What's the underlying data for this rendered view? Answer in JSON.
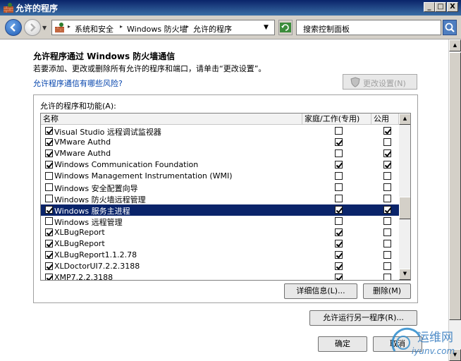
{
  "window": {
    "title": "允许的程序",
    "minimize": "_",
    "maximize": "□",
    "close": "X"
  },
  "address": {
    "crumbs": [
      "系统和安全",
      "Windows 防火墙",
      "允许的程序"
    ],
    "search_placeholder": "搜索控制面板"
  },
  "main": {
    "heading": "允许程序通过 Windows 防火墙通信",
    "description": "若要添加、更改或删除所有允许的程序和端口，请单击“更改设置”。",
    "risk_link": "允许程序通信有哪些风险?",
    "change_settings": "更改设置(N)",
    "group_label": "允许的程序和功能(A):",
    "columns": {
      "name": "名称",
      "home": "家庭/工作(专用)",
      "public": "公用"
    },
    "rows": [
      {
        "name": "Visual Studio 远程调试监视器",
        "enabled": true,
        "home": false,
        "public": true,
        "selected": false
      },
      {
        "name": "VMware Authd",
        "enabled": true,
        "home": true,
        "public": false,
        "selected": false
      },
      {
        "name": "VMware Authd",
        "enabled": true,
        "home": false,
        "public": true,
        "selected": false
      },
      {
        "name": "Windows Communication Foundation",
        "enabled": true,
        "home": true,
        "public": true,
        "selected": false
      },
      {
        "name": "Windows Management Instrumentation (WMI)",
        "enabled": false,
        "home": false,
        "public": false,
        "selected": false
      },
      {
        "name": "Windows 安全配置向导",
        "enabled": false,
        "home": false,
        "public": false,
        "selected": false
      },
      {
        "name": "Windows 防火墙远程管理",
        "enabled": false,
        "home": false,
        "public": false,
        "selected": false
      },
      {
        "name": "Windows 服务主进程",
        "enabled": true,
        "home": true,
        "public": true,
        "selected": true
      },
      {
        "name": "Windows 远程管理",
        "enabled": false,
        "home": false,
        "public": false,
        "selected": false
      },
      {
        "name": "XLBugReport",
        "enabled": true,
        "home": true,
        "public": false,
        "selected": false
      },
      {
        "name": "XLBugReport",
        "enabled": true,
        "home": true,
        "public": false,
        "selected": false
      },
      {
        "name": "XLBugReport1.1.2.78",
        "enabled": true,
        "home": true,
        "public": false,
        "selected": false
      },
      {
        "name": "XLDoctorUI7.2.2.3188",
        "enabled": true,
        "home": true,
        "public": false,
        "selected": false
      },
      {
        "name": "XMP7.2.2.3188",
        "enabled": true,
        "home": true,
        "public": false,
        "selected": false
      }
    ],
    "details_button": "详细信息(L)...",
    "delete_button": "删除(M)",
    "allow_another_button": "允许运行另一程序(R)...",
    "ok_button": "确定",
    "cancel_button": "取消"
  },
  "watermark": {
    "line1": "运维网",
    "line2": "iyunv.com"
  }
}
